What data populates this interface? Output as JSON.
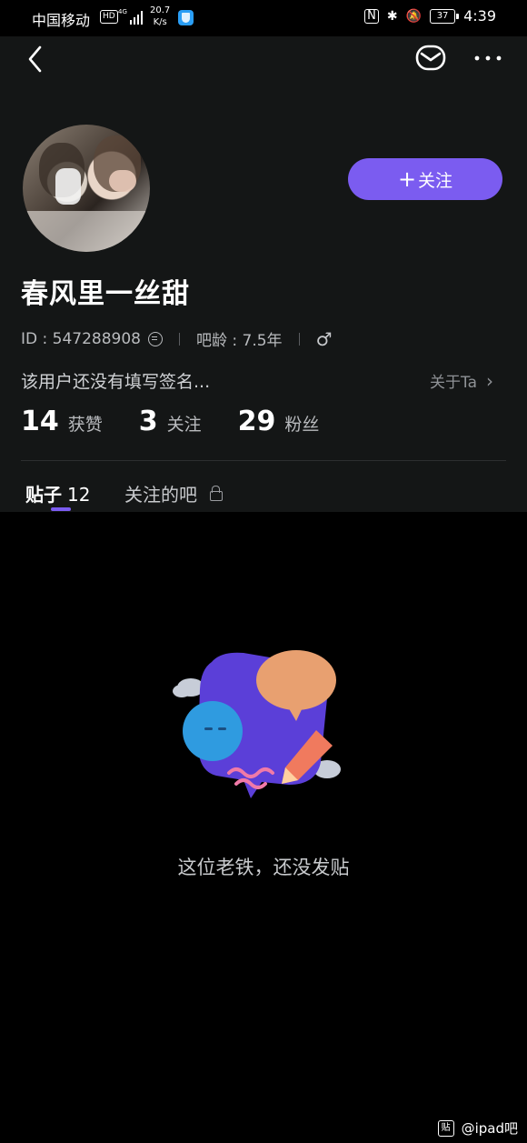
{
  "status_bar": {
    "carrier": "中国移动",
    "hd": "HD",
    "network": "4G",
    "speed_value": "20.7",
    "speed_unit": "K/s",
    "nfc": "N",
    "battery": "37",
    "time": "4:39"
  },
  "profile": {
    "username": "春风里一丝甜",
    "id_label": "ID : 547288908",
    "bar_age_label": "吧龄 : 7.5年",
    "bio": "该用户还没有填写签名...",
    "about": "关于Ta",
    "follow_button": "关注"
  },
  "stats": [
    {
      "num": "14",
      "label": "获赞"
    },
    {
      "num": "3",
      "label": "关注"
    },
    {
      "num": "29",
      "label": "粉丝"
    }
  ],
  "tabs": {
    "posts_label": "贴子",
    "posts_count": "12",
    "followed_bars_label": "关注的吧"
  },
  "empty_state": {
    "text": "这位老铁，还没发贴"
  },
  "watermark": {
    "logo": "贴",
    "text": "@ipad吧"
  },
  "colors": {
    "accent": "#7b5cf0",
    "header_bg": "#141616",
    "page_bg": "#000000"
  }
}
